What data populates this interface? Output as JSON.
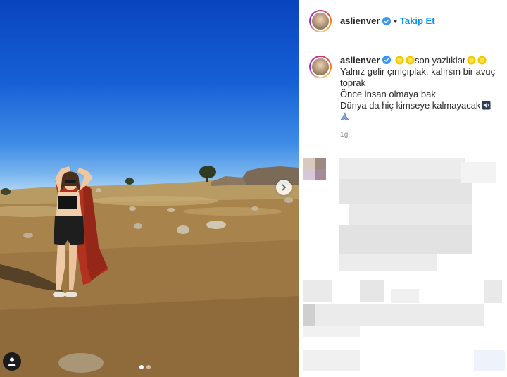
{
  "post": {
    "username": "aslienver",
    "follow_label": "Takip Et",
    "separator": "•",
    "caption": {
      "username": "aslienver",
      "title": "son yazlıklar",
      "lines": [
        "Yalnız gelir çırılçıplak, kalırsın bir avuç toprak",
        "Önce insan olmaya bak",
        "Dünya da hiç kimseye kalmayacak"
      ],
      "emoji_end": "🙏"
    },
    "timestamp": "1g"
  },
  "carousel": {
    "count": 2,
    "active": 1
  },
  "icons": {
    "verified": "verified-badge-icon",
    "next": "chevron-right-icon",
    "tag": "user-tag-icon",
    "sun": "sun-emoji-icon",
    "speaker": "speaker-emoji-icon",
    "pray": "pray-emoji-icon"
  },
  "colors": {
    "accent": "#0095f6",
    "verified": "#3897f0",
    "text": "#262626",
    "muted": "#8e8e8e"
  }
}
